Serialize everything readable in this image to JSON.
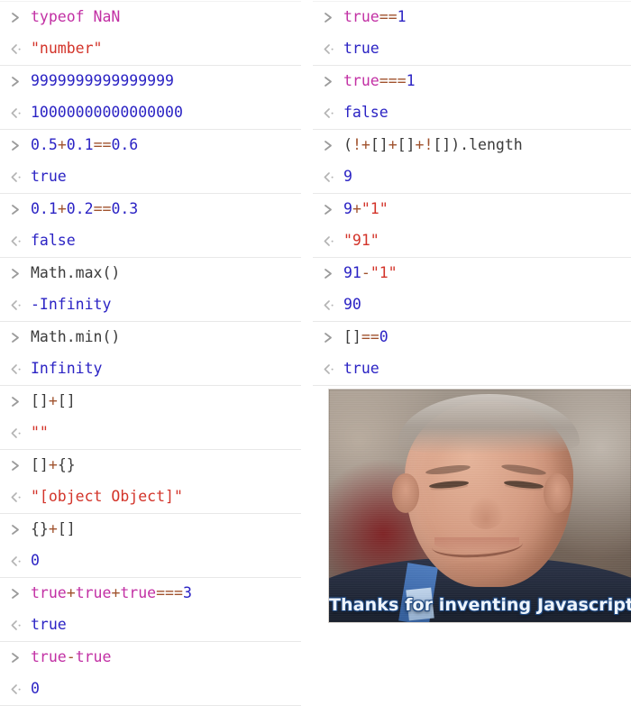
{
  "colors": {
    "keyword": "#c230a4",
    "number": "#2b23c4",
    "string": "#d3342a",
    "operator": "#a0522d",
    "plain": "#3b3b3b",
    "marker": "#9b9b9b",
    "separator": "#e8e8e8",
    "background": "#ffffff"
  },
  "markers": {
    "input": ">",
    "output": "<"
  },
  "left_column": [
    {
      "input_tokens": [
        {
          "text": "typeof ",
          "kind": "keyword"
        },
        {
          "text": "NaN",
          "kind": "keyword"
        }
      ],
      "input_text": "typeof NaN",
      "output_tokens": [
        {
          "text": "\"number\"",
          "kind": "string"
        }
      ],
      "output_text": "\"number\""
    },
    {
      "input_tokens": [
        {
          "text": "9999999999999999",
          "kind": "number"
        }
      ],
      "input_text": "9999999999999999",
      "output_tokens": [
        {
          "text": "10000000000000000",
          "kind": "number"
        }
      ],
      "output_text": "10000000000000000"
    },
    {
      "input_tokens": [
        {
          "text": "0.5",
          "kind": "number"
        },
        {
          "text": "+",
          "kind": "operator"
        },
        {
          "text": "0.1",
          "kind": "number"
        },
        {
          "text": "==",
          "kind": "operator"
        },
        {
          "text": "0.6",
          "kind": "number"
        }
      ],
      "input_text": "0.5+0.1==0.6",
      "output_tokens": [
        {
          "text": "true",
          "kind": "number"
        }
      ],
      "output_text": "true"
    },
    {
      "input_tokens": [
        {
          "text": "0.1",
          "kind": "number"
        },
        {
          "text": "+",
          "kind": "operator"
        },
        {
          "text": "0.2",
          "kind": "number"
        },
        {
          "text": "==",
          "kind": "operator"
        },
        {
          "text": "0.3",
          "kind": "number"
        }
      ],
      "input_text": "0.1+0.2==0.3",
      "output_tokens": [
        {
          "text": "false",
          "kind": "number"
        }
      ],
      "output_text": "false"
    },
    {
      "input_tokens": [
        {
          "text": "Math.max()",
          "kind": "plain"
        }
      ],
      "input_text": "Math.max()",
      "output_tokens": [
        {
          "text": "-Infinity",
          "kind": "number"
        }
      ],
      "output_text": "-Infinity"
    },
    {
      "input_tokens": [
        {
          "text": "Math.min()",
          "kind": "plain"
        }
      ],
      "input_text": "Math.min()",
      "output_tokens": [
        {
          "text": "Infinity",
          "kind": "number"
        }
      ],
      "output_text": "Infinity"
    },
    {
      "input_tokens": [
        {
          "text": "[]",
          "kind": "plain"
        },
        {
          "text": "+",
          "kind": "operator"
        },
        {
          "text": "[]",
          "kind": "plain"
        }
      ],
      "input_text": "[]+[]",
      "output_tokens": [
        {
          "text": "\"\"",
          "kind": "string"
        }
      ],
      "output_text": "\"\""
    },
    {
      "input_tokens": [
        {
          "text": "[]",
          "kind": "plain"
        },
        {
          "text": "+",
          "kind": "operator"
        },
        {
          "text": "{}",
          "kind": "plain"
        }
      ],
      "input_text": "[]+{}",
      "output_tokens": [
        {
          "text": "\"[object Object]\"",
          "kind": "string"
        }
      ],
      "output_text": "\"[object Object]\""
    },
    {
      "input_tokens": [
        {
          "text": "{}",
          "kind": "plain"
        },
        {
          "text": "+",
          "kind": "operator"
        },
        {
          "text": "[]",
          "kind": "plain"
        }
      ],
      "input_text": "{}+[]",
      "output_tokens": [
        {
          "text": "0",
          "kind": "number"
        }
      ],
      "output_text": "0"
    },
    {
      "input_tokens": [
        {
          "text": "true",
          "kind": "keyword"
        },
        {
          "text": "+",
          "kind": "operator"
        },
        {
          "text": "true",
          "kind": "keyword"
        },
        {
          "text": "+",
          "kind": "operator"
        },
        {
          "text": "true",
          "kind": "keyword"
        },
        {
          "text": "===",
          "kind": "operator"
        },
        {
          "text": "3",
          "kind": "number"
        }
      ],
      "input_text": "true+true+true===3",
      "output_tokens": [
        {
          "text": "true",
          "kind": "number"
        }
      ],
      "output_text": "true"
    },
    {
      "input_tokens": [
        {
          "text": "true",
          "kind": "keyword"
        },
        {
          "text": "-",
          "kind": "operator"
        },
        {
          "text": "true",
          "kind": "keyword"
        }
      ],
      "input_text": "true-true",
      "output_tokens": [
        {
          "text": "0",
          "kind": "number"
        }
      ],
      "output_text": "0"
    }
  ],
  "right_column": [
    {
      "input_tokens": [
        {
          "text": "true",
          "kind": "keyword"
        },
        {
          "text": "==",
          "kind": "operator"
        },
        {
          "text": "1",
          "kind": "number"
        }
      ],
      "input_text": "true==1",
      "output_tokens": [
        {
          "text": "true",
          "kind": "number"
        }
      ],
      "output_text": "true"
    },
    {
      "input_tokens": [
        {
          "text": "true",
          "kind": "keyword"
        },
        {
          "text": "===",
          "kind": "operator"
        },
        {
          "text": "1",
          "kind": "number"
        }
      ],
      "input_text": "true===1",
      "output_tokens": [
        {
          "text": "false",
          "kind": "number"
        }
      ],
      "output_text": "false"
    },
    {
      "input_tokens": [
        {
          "text": "(",
          "kind": "plain"
        },
        {
          "text": "!",
          "kind": "operator"
        },
        {
          "text": "+",
          "kind": "operator"
        },
        {
          "text": "[]",
          "kind": "plain"
        },
        {
          "text": "+",
          "kind": "operator"
        },
        {
          "text": "[]",
          "kind": "plain"
        },
        {
          "text": "+",
          "kind": "operator"
        },
        {
          "text": "!",
          "kind": "operator"
        },
        {
          "text": "[]",
          "kind": "plain"
        },
        {
          "text": ").length",
          "kind": "plain"
        }
      ],
      "input_text": "(!+[]+[]+![]).length",
      "output_tokens": [
        {
          "text": "9",
          "kind": "number"
        }
      ],
      "output_text": "9"
    },
    {
      "input_tokens": [
        {
          "text": "9",
          "kind": "number"
        },
        {
          "text": "+",
          "kind": "operator"
        },
        {
          "text": "\"1\"",
          "kind": "string"
        }
      ],
      "input_text": "9+\"1\"",
      "output_tokens": [
        {
          "text": "\"91\"",
          "kind": "string"
        }
      ],
      "output_text": "\"91\""
    },
    {
      "input_tokens": [
        {
          "text": "91",
          "kind": "number"
        },
        {
          "text": "-",
          "kind": "operator"
        },
        {
          "text": "\"1\"",
          "kind": "string"
        }
      ],
      "input_text": "91-\"1\"",
      "output_tokens": [
        {
          "text": "90",
          "kind": "number"
        }
      ],
      "output_text": "90"
    },
    {
      "input_tokens": [
        {
          "text": "[]",
          "kind": "plain"
        },
        {
          "text": "==",
          "kind": "operator"
        },
        {
          "text": "0",
          "kind": "number"
        }
      ],
      "input_text": "[]==0",
      "output_tokens": [
        {
          "text": "true",
          "kind": "number"
        }
      ],
      "output_text": "true"
    }
  ],
  "meme": {
    "caption": "Thanks for inventing Javascript",
    "alt": "photo of a smiling man",
    "caption_color": "#eef4fb"
  }
}
